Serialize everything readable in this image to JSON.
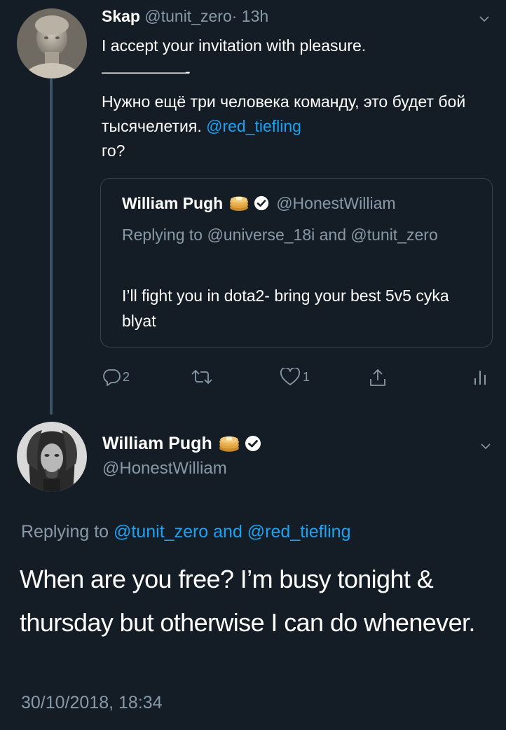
{
  "tweet1": {
    "author_name": "Skap",
    "author_handle": "@tunit_zero",
    "time": "· 13h",
    "line1": "I accept your invitation with pleasure.",
    "separator": "———————-",
    "text_before_mention": "Нужно ещё три человека команду, это будет бой тысячелетия. ",
    "mention": "@red_tiefling",
    "text_after_mention": "го?",
    "quoted": {
      "author_name": "William Pugh",
      "author_handle": "@HonestWilliam",
      "replying_to": "Replying to @universe_18i and @tunit_zero",
      "text": "I’ll fight you in dota2- bring your best 5v5 cyka blyat"
    },
    "actions": {
      "reply_count": "2",
      "retweet_count": "",
      "like_count": "1"
    }
  },
  "tweet2": {
    "author_name": "William Pugh",
    "author_handle": "@HonestWilliam",
    "replying_prefix": "Replying to ",
    "replying_mentions": "@tunit_zero and @red_tiefling",
    "text": "When are you free? I’m busy tonight & thursday but otherwise I can do whenever.",
    "timestamp": "30/10/2018, 18:34"
  },
  "icons": {
    "reply": "reply-icon",
    "retweet": "retweet-icon",
    "like": "heart-icon",
    "share": "share-icon",
    "analytics": "analytics-icon",
    "menu": "chevron-down-icon",
    "verified": "verified-badge-icon",
    "emoji": "pancakes-emoji-icon"
  },
  "colors": {
    "background": "#141d26",
    "text": "#ffffff",
    "muted": "#8899a6",
    "link": "#1da1f2",
    "border": "#38444d",
    "thread_line": "#3d5466"
  }
}
